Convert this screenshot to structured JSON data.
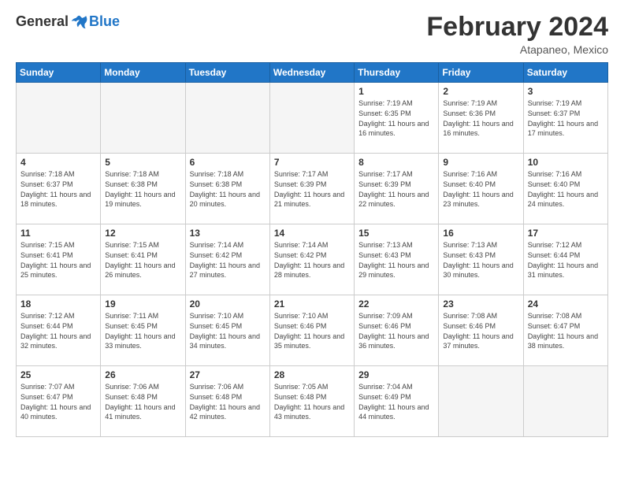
{
  "header": {
    "logo_general": "General",
    "logo_blue": "Blue",
    "title": "February 2024",
    "subtitle": "Atapaneo, Mexico"
  },
  "days_header": [
    "Sunday",
    "Monday",
    "Tuesday",
    "Wednesday",
    "Thursday",
    "Friday",
    "Saturday"
  ],
  "weeks": [
    [
      {
        "day": "",
        "info": ""
      },
      {
        "day": "",
        "info": ""
      },
      {
        "day": "",
        "info": ""
      },
      {
        "day": "",
        "info": ""
      },
      {
        "day": "1",
        "info": "Sunrise: 7:19 AM\nSunset: 6:35 PM\nDaylight: 11 hours and 16 minutes."
      },
      {
        "day": "2",
        "info": "Sunrise: 7:19 AM\nSunset: 6:36 PM\nDaylight: 11 hours and 16 minutes."
      },
      {
        "day": "3",
        "info": "Sunrise: 7:19 AM\nSunset: 6:37 PM\nDaylight: 11 hours and 17 minutes."
      }
    ],
    [
      {
        "day": "4",
        "info": "Sunrise: 7:18 AM\nSunset: 6:37 PM\nDaylight: 11 hours and 18 minutes."
      },
      {
        "day": "5",
        "info": "Sunrise: 7:18 AM\nSunset: 6:38 PM\nDaylight: 11 hours and 19 minutes."
      },
      {
        "day": "6",
        "info": "Sunrise: 7:18 AM\nSunset: 6:38 PM\nDaylight: 11 hours and 20 minutes."
      },
      {
        "day": "7",
        "info": "Sunrise: 7:17 AM\nSunset: 6:39 PM\nDaylight: 11 hours and 21 minutes."
      },
      {
        "day": "8",
        "info": "Sunrise: 7:17 AM\nSunset: 6:39 PM\nDaylight: 11 hours and 22 minutes."
      },
      {
        "day": "9",
        "info": "Sunrise: 7:16 AM\nSunset: 6:40 PM\nDaylight: 11 hours and 23 minutes."
      },
      {
        "day": "10",
        "info": "Sunrise: 7:16 AM\nSunset: 6:40 PM\nDaylight: 11 hours and 24 minutes."
      }
    ],
    [
      {
        "day": "11",
        "info": "Sunrise: 7:15 AM\nSunset: 6:41 PM\nDaylight: 11 hours and 25 minutes."
      },
      {
        "day": "12",
        "info": "Sunrise: 7:15 AM\nSunset: 6:41 PM\nDaylight: 11 hours and 26 minutes."
      },
      {
        "day": "13",
        "info": "Sunrise: 7:14 AM\nSunset: 6:42 PM\nDaylight: 11 hours and 27 minutes."
      },
      {
        "day": "14",
        "info": "Sunrise: 7:14 AM\nSunset: 6:42 PM\nDaylight: 11 hours and 28 minutes."
      },
      {
        "day": "15",
        "info": "Sunrise: 7:13 AM\nSunset: 6:43 PM\nDaylight: 11 hours and 29 minutes."
      },
      {
        "day": "16",
        "info": "Sunrise: 7:13 AM\nSunset: 6:43 PM\nDaylight: 11 hours and 30 minutes."
      },
      {
        "day": "17",
        "info": "Sunrise: 7:12 AM\nSunset: 6:44 PM\nDaylight: 11 hours and 31 minutes."
      }
    ],
    [
      {
        "day": "18",
        "info": "Sunrise: 7:12 AM\nSunset: 6:44 PM\nDaylight: 11 hours and 32 minutes."
      },
      {
        "day": "19",
        "info": "Sunrise: 7:11 AM\nSunset: 6:45 PM\nDaylight: 11 hours and 33 minutes."
      },
      {
        "day": "20",
        "info": "Sunrise: 7:10 AM\nSunset: 6:45 PM\nDaylight: 11 hours and 34 minutes."
      },
      {
        "day": "21",
        "info": "Sunrise: 7:10 AM\nSunset: 6:46 PM\nDaylight: 11 hours and 35 minutes."
      },
      {
        "day": "22",
        "info": "Sunrise: 7:09 AM\nSunset: 6:46 PM\nDaylight: 11 hours and 36 minutes."
      },
      {
        "day": "23",
        "info": "Sunrise: 7:08 AM\nSunset: 6:46 PM\nDaylight: 11 hours and 37 minutes."
      },
      {
        "day": "24",
        "info": "Sunrise: 7:08 AM\nSunset: 6:47 PM\nDaylight: 11 hours and 38 minutes."
      }
    ],
    [
      {
        "day": "25",
        "info": "Sunrise: 7:07 AM\nSunset: 6:47 PM\nDaylight: 11 hours and 40 minutes."
      },
      {
        "day": "26",
        "info": "Sunrise: 7:06 AM\nSunset: 6:48 PM\nDaylight: 11 hours and 41 minutes."
      },
      {
        "day": "27",
        "info": "Sunrise: 7:06 AM\nSunset: 6:48 PM\nDaylight: 11 hours and 42 minutes."
      },
      {
        "day": "28",
        "info": "Sunrise: 7:05 AM\nSunset: 6:48 PM\nDaylight: 11 hours and 43 minutes."
      },
      {
        "day": "29",
        "info": "Sunrise: 7:04 AM\nSunset: 6:49 PM\nDaylight: 11 hours and 44 minutes."
      },
      {
        "day": "",
        "info": ""
      },
      {
        "day": "",
        "info": ""
      }
    ]
  ]
}
